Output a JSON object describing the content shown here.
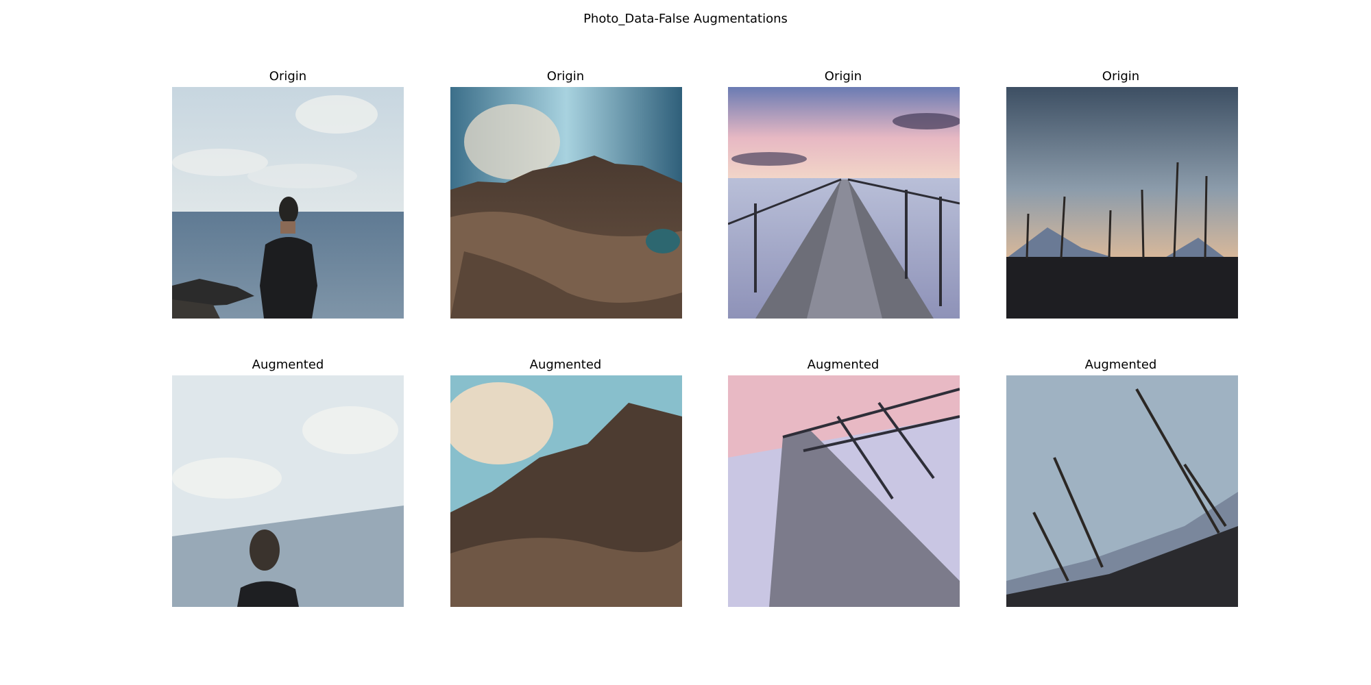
{
  "figure": {
    "title": "Photo_Data-False Augmentations",
    "origin_titles": [
      "Origin",
      "Origin",
      "Origin",
      "Origin"
    ],
    "augmented_titles": [
      "Augmented",
      "Augmented",
      "Augmented",
      "Augmented"
    ]
  },
  "images": {
    "origin": [
      {
        "subject": "man-looking-at-sea"
      },
      {
        "subject": "desert-rock-formations"
      },
      {
        "subject": "pier-at-sunset"
      },
      {
        "subject": "dead-trees-mountains-dusk"
      }
    ],
    "augmented": [
      {
        "subject": "man-looking-at-sea",
        "transform": "rotated-zoomed"
      },
      {
        "subject": "desert-rock-formations",
        "transform": "rotated-zoomed"
      },
      {
        "subject": "pier-at-sunset",
        "transform": "rotated-zoomed"
      },
      {
        "subject": "dead-trees-mountains-dusk",
        "transform": "rotated-zoomed"
      }
    ]
  }
}
